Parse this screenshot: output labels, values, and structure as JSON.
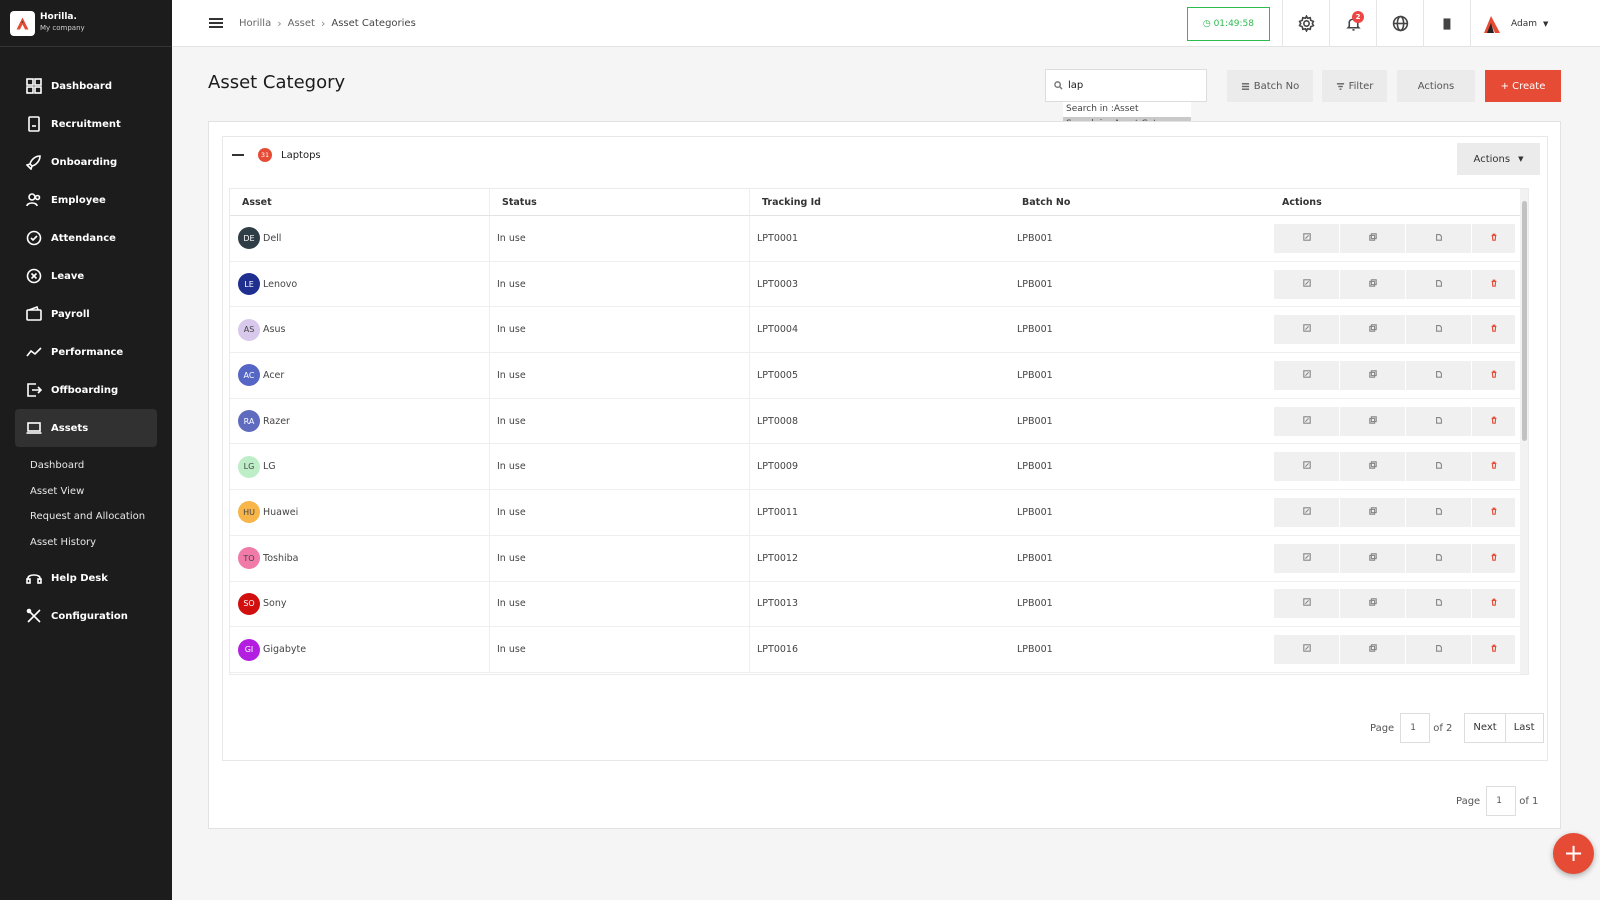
{
  "brand": {
    "name": "Horilla.",
    "company": "My company"
  },
  "sidebar": {
    "items": [
      {
        "label": "Dashboard",
        "icon": "dashboard-icon"
      },
      {
        "label": "Recruitment",
        "icon": "recruitment-icon"
      },
      {
        "label": "Onboarding",
        "icon": "rocket-icon"
      },
      {
        "label": "Employee",
        "icon": "users-icon"
      },
      {
        "label": "Attendance",
        "icon": "check-circle-icon"
      },
      {
        "label": "Leave",
        "icon": "x-circle-icon"
      },
      {
        "label": "Payroll",
        "icon": "wallet-icon"
      },
      {
        "label": "Performance",
        "icon": "trend-icon"
      },
      {
        "label": "Offboarding",
        "icon": "exit-icon"
      },
      {
        "label": "Assets",
        "icon": "laptop-icon"
      }
    ],
    "assets_sub": [
      "Dashboard",
      "Asset View",
      "Request and Allocation",
      "Asset History"
    ],
    "bottom_items": [
      {
        "label": "Help Desk",
        "icon": "headset-icon"
      },
      {
        "label": "Configuration",
        "icon": "tools-icon"
      }
    ]
  },
  "topbar": {
    "breadcrumb": [
      "Horilla",
      "Asset",
      "Asset Categories"
    ],
    "clock": "01:49:58",
    "notification_count": "2",
    "user_name": "Adam"
  },
  "page": {
    "title": "Asset Category",
    "search_value": "lap",
    "search_options": [
      "Search in :Asset",
      "Search in :Asset Category"
    ],
    "batch_btn": "Batch No",
    "filter_btn": "Filter",
    "actions_btn": "Actions",
    "create_btn": "+ Create"
  },
  "group": {
    "name": "Laptops",
    "count": "31",
    "actions_label": "Actions"
  },
  "table": {
    "headers": [
      "Asset",
      "Status",
      "Tracking Id",
      "Batch No",
      "Actions"
    ],
    "rows": [
      {
        "initials": "DE",
        "name": "Dell",
        "status": "In use",
        "tracking": "LPT0001",
        "batch": "LPB001",
        "color": "#2f3e46"
      },
      {
        "initials": "LE",
        "name": "Lenovo",
        "status": "In use",
        "tracking": "LPT0003",
        "batch": "LPB001",
        "color": "#1f2f8f"
      },
      {
        "initials": "AS",
        "name": "Asus",
        "status": "In use",
        "tracking": "LPT0004",
        "batch": "LPB001",
        "color": "#d7c8ec"
      },
      {
        "initials": "AC",
        "name": "Acer",
        "status": "In use",
        "tracking": "LPT0005",
        "batch": "LPB001",
        "color": "#5566c4"
      },
      {
        "initials": "RA",
        "name": "Razer",
        "status": "In use",
        "tracking": "LPT0008",
        "batch": "LPB001",
        "color": "#5f6bbf"
      },
      {
        "initials": "LG",
        "name": "LG",
        "status": "In use",
        "tracking": "LPT0009",
        "batch": "LPB001",
        "color": "#bdeec8"
      },
      {
        "initials": "HU",
        "name": "Huawei",
        "status": "In use",
        "tracking": "LPT0011",
        "batch": "LPB001",
        "color": "#f7b54a"
      },
      {
        "initials": "TO",
        "name": "Toshiba",
        "status": "In use",
        "tracking": "LPT0012",
        "batch": "LPB001",
        "color": "#f07aa8"
      },
      {
        "initials": "SO",
        "name": "Sony",
        "status": "In use",
        "tracking": "LPT0013",
        "batch": "LPB001",
        "color": "#d10f0f"
      },
      {
        "initials": "GI",
        "name": "Gigabyte",
        "status": "In use",
        "tracking": "LPT0016",
        "batch": "LPB001",
        "color": "#b31fe0"
      }
    ]
  },
  "pagination_inner": {
    "page_label": "Page",
    "page": "1",
    "of": "of 2",
    "next": "Next",
    "last": "Last"
  },
  "pagination_outer": {
    "page_label": "Page",
    "page": "1",
    "of": "of 1"
  },
  "colors": {
    "accent": "#e54b35",
    "sidebar_bg": "#1c1c1c",
    "clock_green": "#2dbb4d"
  }
}
